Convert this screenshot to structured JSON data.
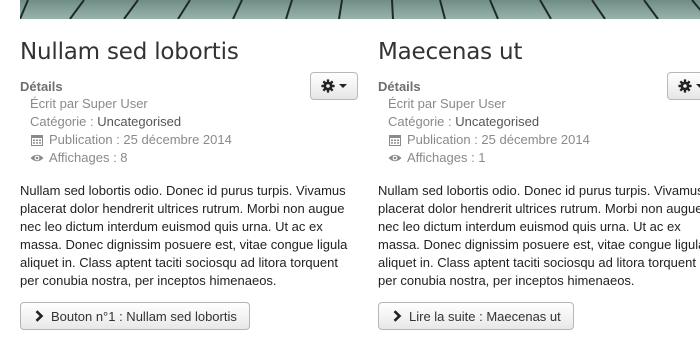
{
  "articles": [
    {
      "title": "Nullam sed lobortis",
      "details_label": "Détails",
      "author": "Écrit par Super User",
      "category_prefix": "Catégorie : ",
      "category": "Uncategorised",
      "published": "Publication : 25 décembre 2014",
      "hits": "Affichages : 8",
      "text": "Nullam sed lobortis odio. Donec id purus turpis. Vivamus placerat dolor hendrerit ultrices rutrum. Morbi non augue nec leo dictum interdum euismod quis urna. Ut ac ex massa. Donec dignissim posuere est, vitae congue ligula aliquet in. Class aptent taciti sociosqu ad litora torquent per conubia nostra, per inceptos himenaeos.",
      "button_label": "Bouton n°1 : Nullam sed lobortis"
    },
    {
      "title": "Maecenas ut",
      "details_label": "Détails",
      "author": "Écrit par Super User",
      "category_prefix": "Catégorie : ",
      "category": "Uncategorised",
      "published": "Publication : 25 décembre 2014",
      "hits": "Affichages : 1",
      "text": "Nullam sed lobortis odio. Donec id purus turpis. Vivamus placerat dolor hendrerit ultrices rutrum. Morbi non augue nec leo dictum interdum euismod quis urna. Ut ac ex massa. Donec dignissim posuere est, vitae congue ligula aliquet in. Class aptent taciti sociosqu ad litora torquent per conubia nostra, per inceptos himenaeos.",
      "button_label": "Lire la suite : Maecenas ut"
    }
  ],
  "icons": {
    "settings": "gear-icon",
    "dropdown": "caret-down-icon",
    "published": "calendar-icon",
    "hits": "eye-icon",
    "readmore": "chevron-right-icon"
  },
  "colors": {
    "banner": "#86a39b",
    "meta_text": "#8a8a8a",
    "body_text": "#222222"
  }
}
